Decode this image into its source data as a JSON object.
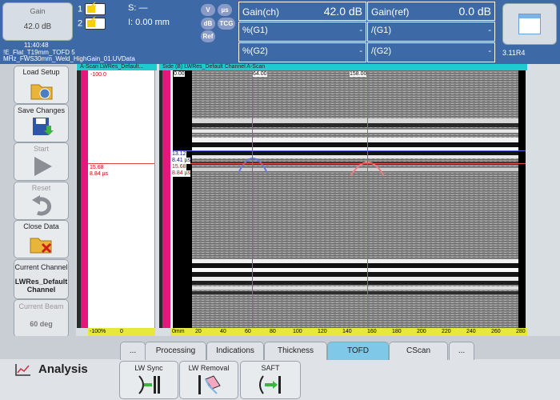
{
  "header": {
    "gain_label": "Gain",
    "gain_value": "42.0 dB",
    "time": "11:40:48",
    "file_line1": "!E_Flat_T19mm_TOFD 5",
    "file_line2": "MHz_FWS30mm_Weld_HighGain_01.UVData",
    "ch1": "1",
    "ch2": "2",
    "s_label": "S: —",
    "i_label": "I:  0.00 mm",
    "pills": [
      "V",
      "µs",
      "dB",
      "TCG",
      "Ref"
    ],
    "cells": [
      {
        "label": "Gain(ch)",
        "value": "42.0 dB"
      },
      {
        "label": "Gain(ref)",
        "value": "0.0 dB"
      },
      {
        "label": "%(G1)",
        "value": "-"
      },
      {
        "label": "/(G1)",
        "value": "-"
      },
      {
        "label": "%(G2)",
        "value": "-"
      },
      {
        "label": "/(G2)",
        "value": "-"
      }
    ],
    "version": "3.11R4"
  },
  "sidebar": {
    "load_setup": "Load Setup",
    "save_changes": "Save Changes",
    "start": "Start",
    "reset": "Reset",
    "close_data": "Close Data",
    "current_channel_label": "Current Channel",
    "current_channel_value": "LWRes_Default Channel",
    "current_beam_label": "Current Beam",
    "current_beam_value": "60 deg"
  },
  "ascan": {
    "title": "A-Scan LWRes_Default...",
    "top_value": "-100.0",
    "cursor_value": "15.68",
    "cursor_time": "8.84 µs",
    "bottom_left": "-100%",
    "bottom_right": "0"
  },
  "side": {
    "title": "Side (B) LWRes_Default Channel A-Scan",
    "top_left": "0.00",
    "cursor_blue_top": "64.00",
    "cursor_red_top": "158.00",
    "left_val_1": "13.12",
    "left_val_2": "8.41 µs",
    "left_val_3": "15.68",
    "left_val_4": "8.84 µs",
    "ruler_unit": "0mm",
    "ruler_ticks": [
      "20",
      "40",
      "60",
      "80",
      "100",
      "120",
      "140",
      "160",
      "180",
      "200",
      "220",
      "240",
      "260",
      "280"
    ]
  },
  "bottom": {
    "mode": "Analysis",
    "tabs": [
      "...",
      "Processing",
      "Indications",
      "Thickness",
      "TOFD",
      "CScan",
      "..."
    ],
    "active_tab": "TOFD",
    "tools": [
      "LW Sync",
      "LW Removal",
      "SAFT"
    ]
  }
}
